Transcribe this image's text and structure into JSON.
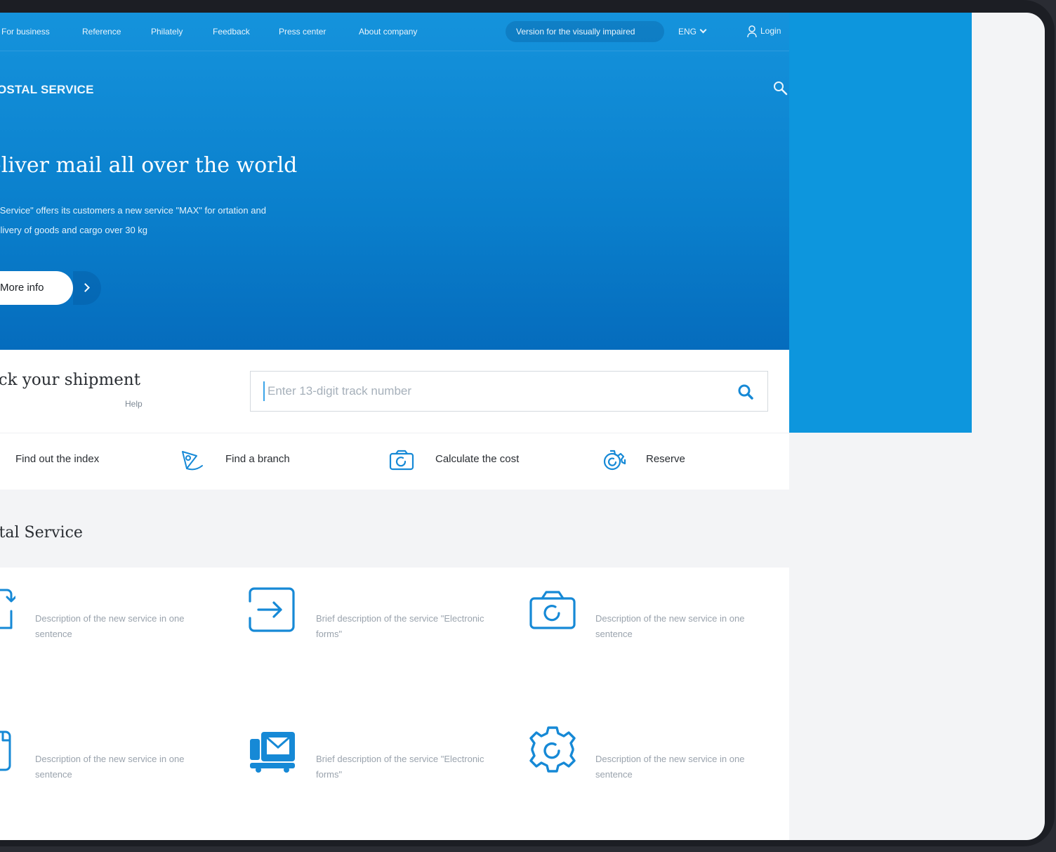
{
  "topnav": {
    "links": [
      "For business",
      "Reference",
      "Philately",
      "Feedback",
      "Press center",
      "About company"
    ],
    "visually_impaired": "Version for the visually impaired",
    "language": "ENG",
    "login": "Login"
  },
  "header": {
    "brand": "OSTAL SERVICE"
  },
  "hero": {
    "headline": "eliver mail all over the world",
    "description": "al Service\" offers its customers a new service \"MAX\" for ortation and delivery of goods and cargo over 30 kg",
    "more_button": "More info"
  },
  "track": {
    "title": "ack your shipment",
    "help": "Help",
    "placeholder": "Enter 13-digit track number",
    "value": ""
  },
  "quick_actions": [
    {
      "label": "Find out the index",
      "icon": "index-icon"
    },
    {
      "label": "Find a branch",
      "icon": "pin-icon"
    },
    {
      "label": "Calculate the cost",
      "icon": "calculator-icon"
    },
    {
      "label": "Reserve",
      "icon": "gear-icon"
    }
  ],
  "services_section": {
    "title": "ostal Service",
    "items": [
      {
        "text": "Description of the new service in one sentence",
        "icon": "transfer-icon"
      },
      {
        "text": "Brief description of the service \"Electronic forms\"",
        "icon": "sign-in-icon"
      },
      {
        "text": "Description of the new service in one sentence",
        "icon": "camera-refresh-icon"
      },
      {
        "text": "Description of the new service in one sentence",
        "icon": "document-icon"
      },
      {
        "text": "Brief description of the service \"Electronic forms\"",
        "icon": "mail-truck-icon"
      },
      {
        "text": "Description of the new service in one sentence",
        "icon": "gear-icon"
      }
    ]
  },
  "colors": {
    "primary": "#0d96dd",
    "icon": "#1689d6",
    "text": "#2a2e33",
    "muted": "#9aa3ad"
  }
}
